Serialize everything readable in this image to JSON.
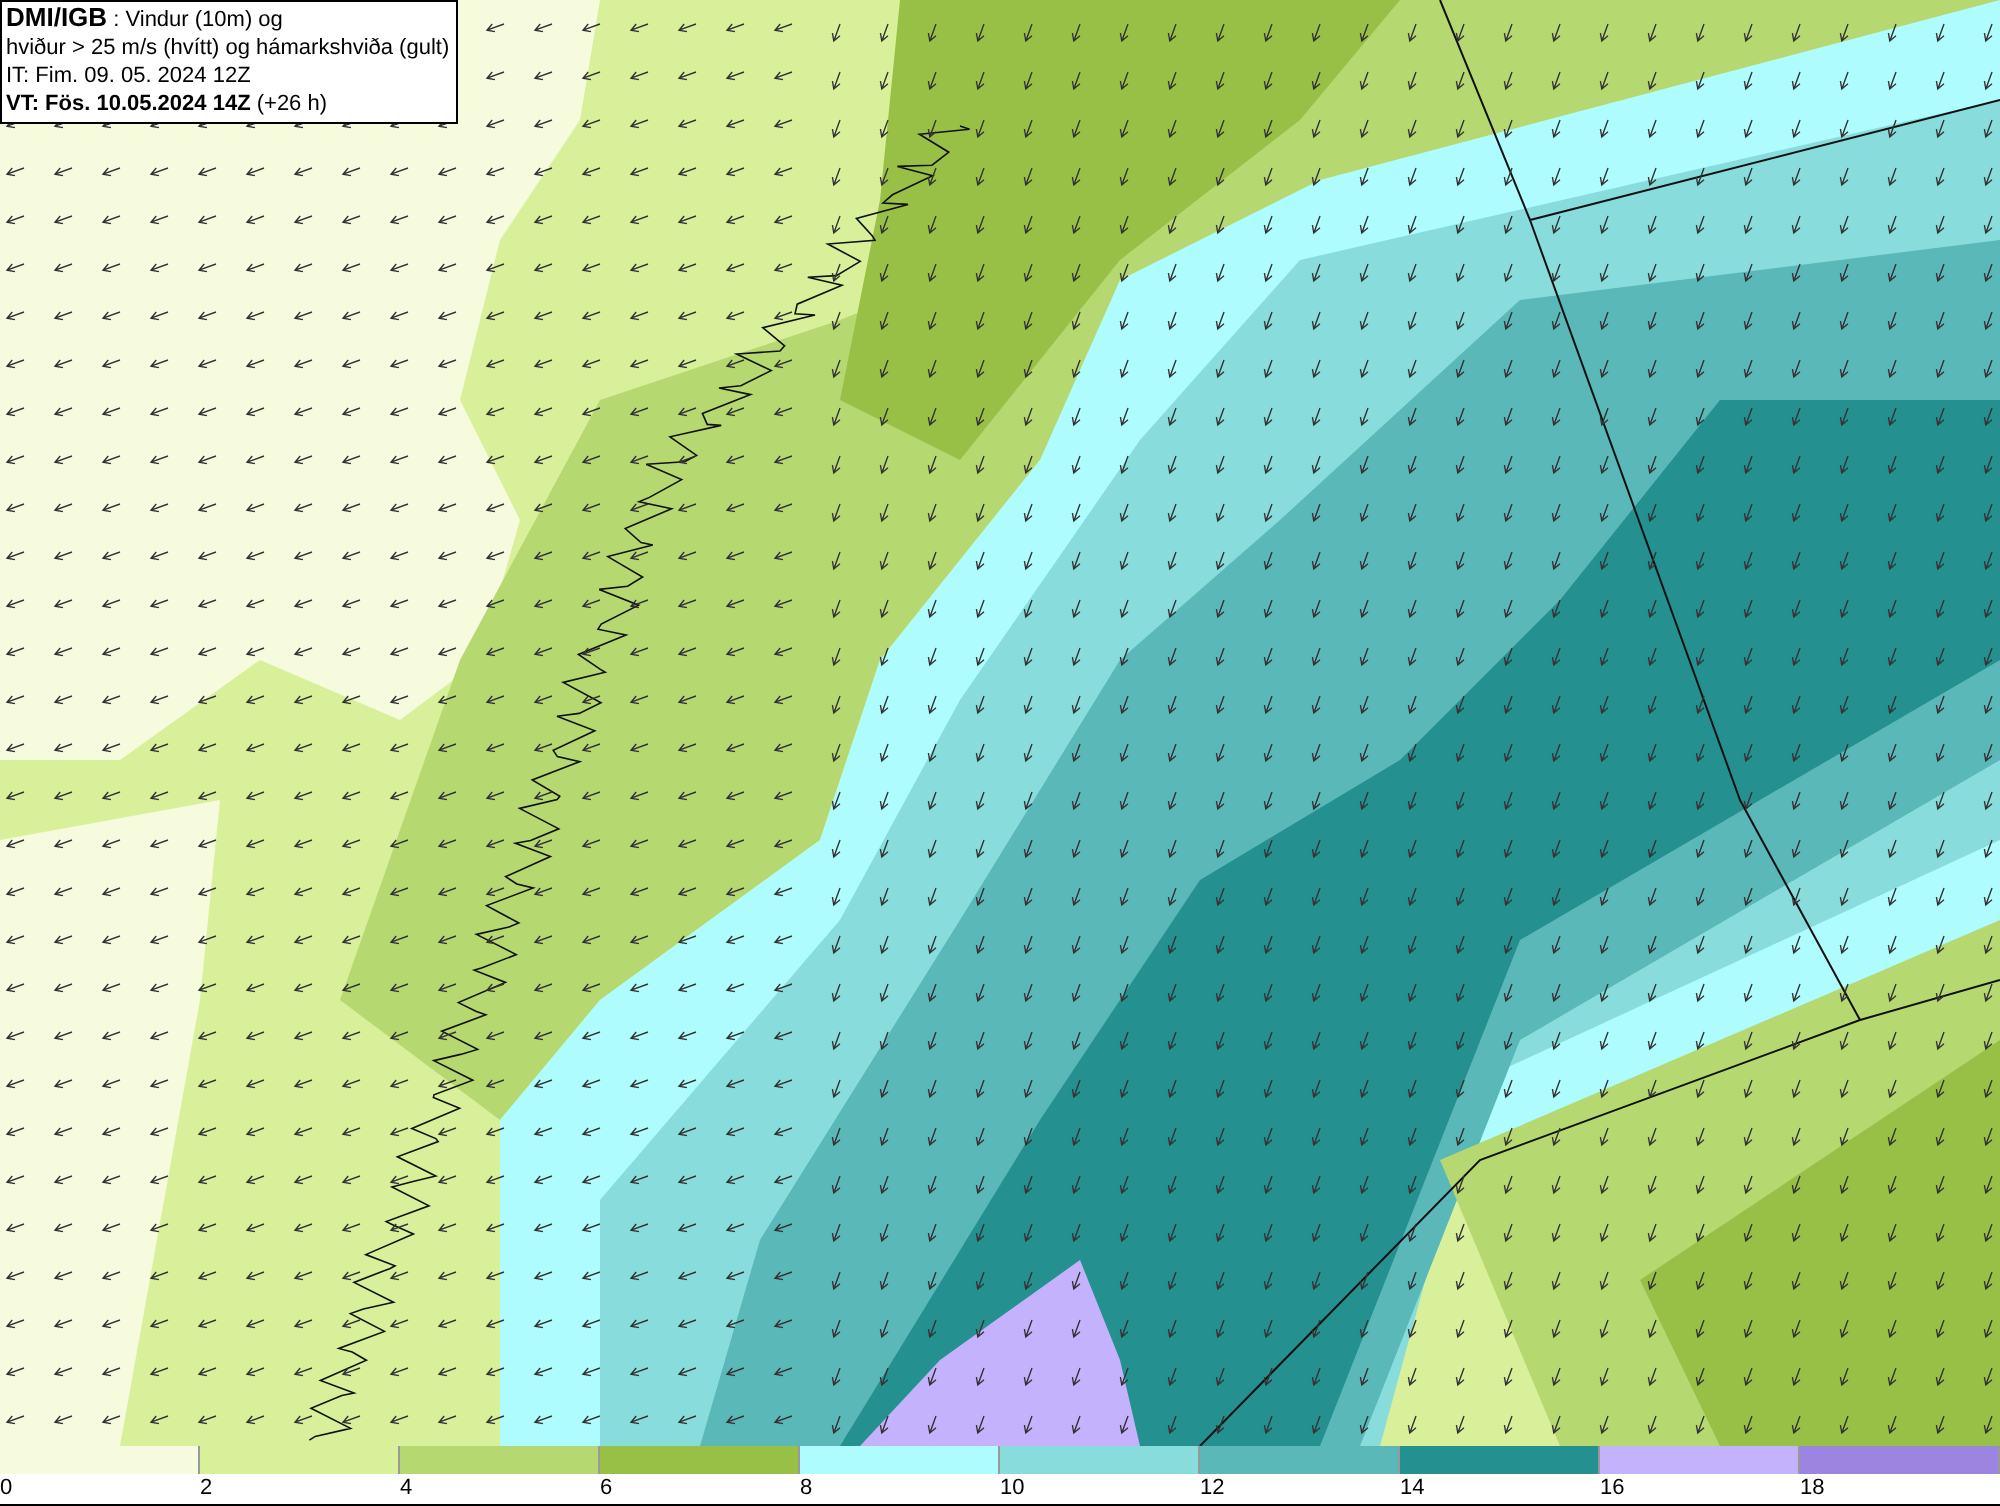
{
  "title_box": {
    "lines": [
      "**DMI/IGB** : Vindur (10m) og",
      "hviður > 25 m/s (hvítt) og hámarkshviða (gult)",
      "IT: Fim. 09. 05. 2024 12Z",
      "**VT: Fös. 10.05.2024 14Z** (+26 h)"
    ]
  },
  "legend": [
    {
      "label": "0",
      "color": "#f5fbdc"
    },
    {
      "label": "2",
      "color": "#d8f09a"
    },
    {
      "label": "4",
      "color": "#b5d970"
    },
    {
      "label": "6",
      "color": "#99c046"
    },
    {
      "label": "8",
      "color": "#aefcfd"
    },
    {
      "label": "10",
      "color": "#88dcdc"
    },
    {
      "label": "12",
      "color": "#5ab8b8"
    },
    {
      "label": "14",
      "color": "#259090"
    },
    {
      "label": "16",
      "color": "#c4b2fc"
    },
    {
      "label": "18",
      "color": "#9b85e0"
    }
  ]
}
